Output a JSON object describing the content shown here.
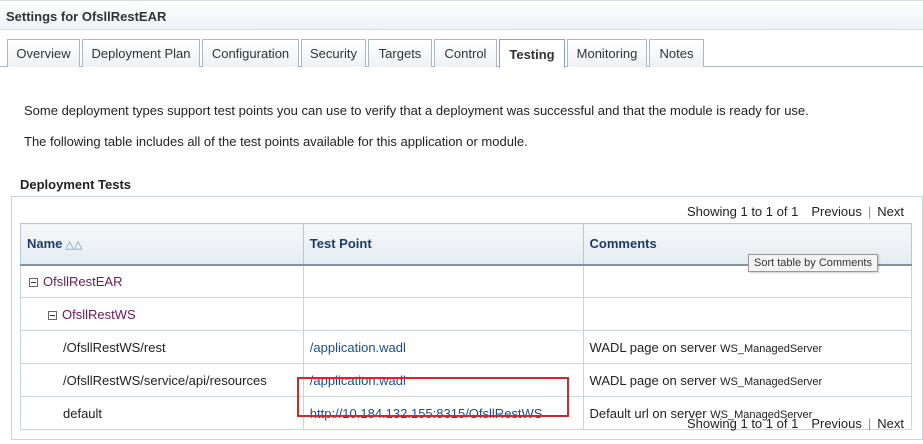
{
  "header": {
    "title": "Settings for OfsllRestEAR"
  },
  "tabs": [
    {
      "label": "Overview"
    },
    {
      "label": "Deployment Plan"
    },
    {
      "label": "Configuration"
    },
    {
      "label": "Security"
    },
    {
      "label": "Targets"
    },
    {
      "label": "Control"
    },
    {
      "label": "Testing",
      "active": true
    },
    {
      "label": "Monitoring"
    },
    {
      "label": "Notes"
    }
  ],
  "intro": {
    "line1": "Some deployment types support test points you can use to verify that a deployment was successful and that the module is ready for use.",
    "line2": "The following table includes all of the test points available for this application or module."
  },
  "section": {
    "title": "Deployment Tests"
  },
  "pager": {
    "showing": "Showing 1 to 1 of 1",
    "previous": "Previous",
    "next": "Next"
  },
  "table": {
    "columns": {
      "name": "Name",
      "test_point": "Test Point",
      "comments": "Comments"
    },
    "tooltip": "Sort table by Comments",
    "rows": [
      {
        "name": "OfsllRestEAR",
        "test_point": "",
        "comment": "",
        "server": ""
      },
      {
        "name": "OfsllRestWS",
        "test_point": "",
        "comment": "",
        "server": ""
      },
      {
        "name": "/OfsllRestWS/rest",
        "test_point": "/application.wadl",
        "comment": "WADL page on server",
        "server": "WS_ManagedServer"
      },
      {
        "name": "/OfsllRestWS/service/api/resources",
        "test_point": "/application.wadl",
        "comment": "WADL page on server",
        "server": "WS_ManagedServer"
      },
      {
        "name": "default",
        "test_point": "http://10.184.132.155:8315/OfsllRestWS",
        "comment": "Default url on server",
        "server": "WS_ManagedServer"
      }
    ]
  }
}
